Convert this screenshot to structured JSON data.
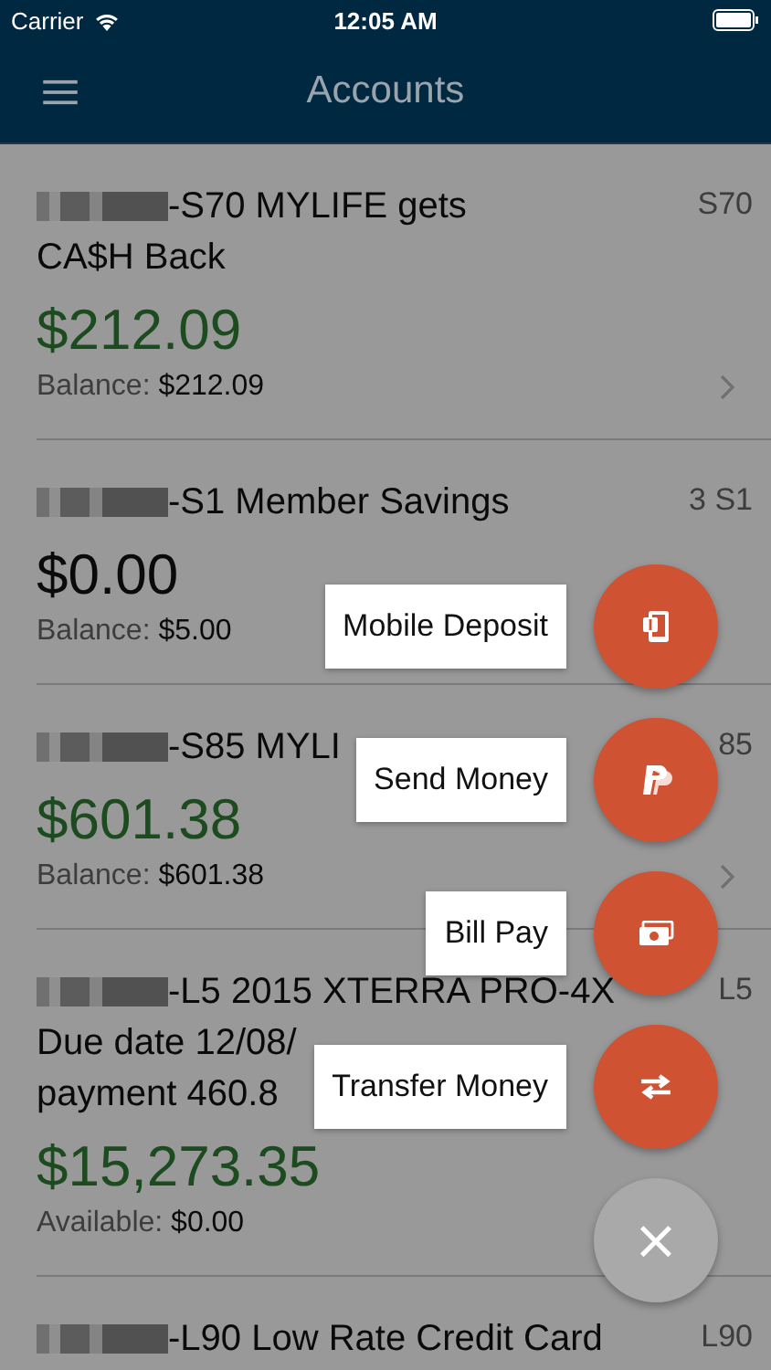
{
  "status_bar": {
    "carrier": "Carrier",
    "time": "12:05 AM"
  },
  "nav": {
    "title": "Accounts"
  },
  "accounts": [
    {
      "name_lines": [
        "-S70 MYLIFE gets",
        "CA$H Back"
      ],
      "code": "S70",
      "amount": "$212.09",
      "positive": true,
      "detail_label": "Balance:",
      "detail_value": "$212.09",
      "chevron": true
    },
    {
      "name_lines": [
        "-S1 Member Savings"
      ],
      "code": "3 S1",
      "amount": "$0.00",
      "positive": false,
      "detail_label": "Balance:",
      "detail_value": "$5.00",
      "chevron": false
    },
    {
      "name_lines": [
        "-S85 MYLI"
      ],
      "code": "85",
      "amount": "$601.38",
      "positive": true,
      "detail_label": "Balance:",
      "detail_value": "$601.38",
      "chevron": true
    },
    {
      "name_lines": [
        "-L5 2015 XTERRA PRO-4X",
        "Due date 12/08/",
        "payment 460.8"
      ],
      "code": "L5",
      "amount": "$15,273.35",
      "positive": true,
      "detail_label": "Available:",
      "detail_value": "$0.00",
      "chevron": false
    },
    {
      "name_lines": [
        "-L90 Low Rate Credit Card"
      ],
      "code": "L90"
    }
  ],
  "actions": [
    {
      "label": "Mobile Deposit",
      "kind": "deposit"
    },
    {
      "label": "Send Money",
      "kind": "send"
    },
    {
      "label": "Bill Pay",
      "kind": "bill"
    },
    {
      "label": "Transfer Money",
      "kind": "transfer"
    }
  ],
  "close_button": {
    "label": "×"
  }
}
